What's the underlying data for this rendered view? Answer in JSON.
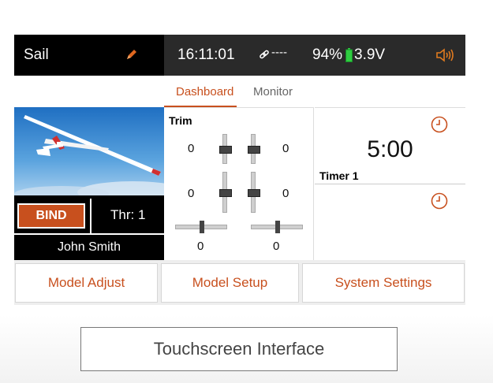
{
  "topbar": {
    "model_name": "Sail",
    "time": "16:11:01",
    "link_status": "----",
    "battery_percent": "94%",
    "voltage": "3.9V",
    "colors": {
      "bar": "#2a2a2a",
      "accent": "#c8501e",
      "battery": "#2ecc40"
    }
  },
  "tabs": [
    {
      "label": "Dashboard",
      "active": true
    },
    {
      "label": "Monitor",
      "active": false
    }
  ],
  "left_panel": {
    "bind_label": "BIND",
    "throttle": "Thr: 1",
    "owner": "John Smith"
  },
  "trim": {
    "title": "Trim",
    "values": {
      "left_upper": "0",
      "right_upper": "0",
      "left_middle": "0",
      "right_middle": "0",
      "left_bottom": "0",
      "right_bottom": "0"
    }
  },
  "timers": [
    {
      "label": "Timer 1",
      "value": "5:00"
    },
    {
      "label": "",
      "value": ""
    }
  ],
  "bottom_buttons": [
    {
      "label": "Model Adjust"
    },
    {
      "label": "Model Setup"
    },
    {
      "label": "System Settings"
    }
  ],
  "caption": "Touchscreen Interface"
}
